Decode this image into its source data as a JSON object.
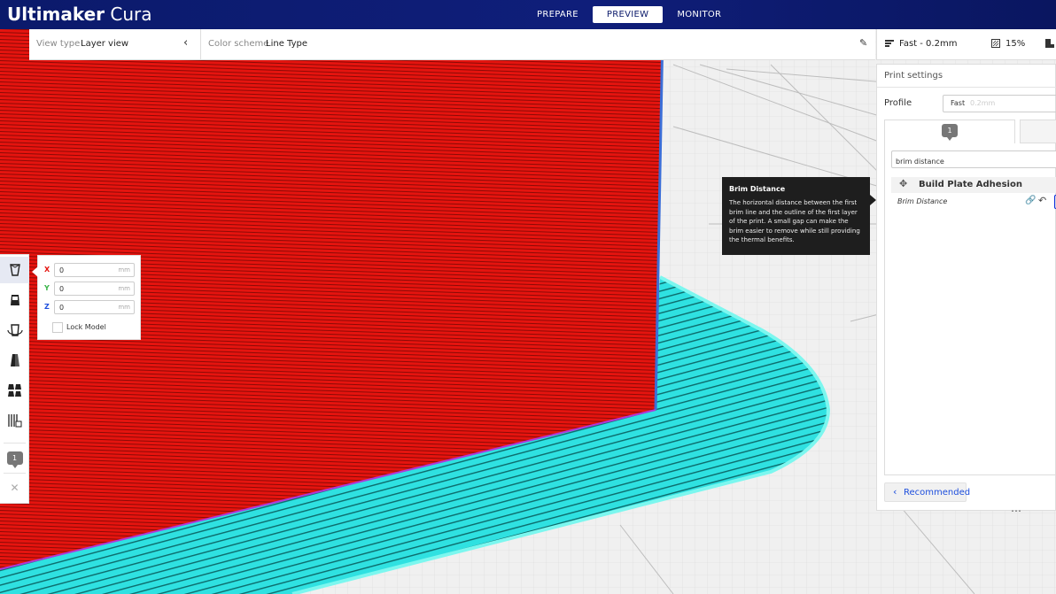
{
  "header": {
    "brand_bold": "Ultimaker",
    "brand_light": "Cura",
    "tabs": [
      {
        "label": "PREPARE",
        "active": false
      },
      {
        "label": "PREVIEW",
        "active": true
      },
      {
        "label": "MONITOR",
        "active": false
      }
    ]
  },
  "view_bar": {
    "view_type_label": "View type",
    "view_type_value": "Layer view",
    "color_scheme_label": "Color scheme",
    "color_scheme_value": "Line Type",
    "collapse_icon": "chevron-left-icon",
    "edit_icon": "pencil-icon"
  },
  "print_summary": {
    "profile": "Fast - 0.2mm",
    "infill": "15%"
  },
  "print_settings": {
    "title": "Print settings",
    "profile_label": "Profile",
    "profile_value": "Fast",
    "profile_subvalue": "0.2mm",
    "search_value": "brim distance",
    "category": "Build Plate Adhesion",
    "setting": "Brim Distance",
    "recommended_label": "Recommended"
  },
  "tooltip": {
    "title": "Brim Distance",
    "body": "The horizontal distance between the first brim line and the outline of the first layer of the print. A small gap can make the brim easier to remove while still providing the thermal benefits."
  },
  "move_panel": {
    "x_label": "X",
    "x_value": "0",
    "x_unit": "mm",
    "y_label": "Y",
    "y_value": "0",
    "y_unit": "mm",
    "z_label": "Z",
    "z_value": "0",
    "z_unit": "mm",
    "lock_label": "Lock Model"
  },
  "toolbar": {
    "tools": [
      "move-tool-icon",
      "scale-tool-icon",
      "rotate-tool-icon",
      "mirror-tool-icon",
      "per-model-settings-icon",
      "support-blocker-icon"
    ],
    "support_badge": "1"
  },
  "colors": {
    "header_bg": "#0f1e7a",
    "accent_blue": "#1d4edd",
    "outer_wall": "#e5140f",
    "skirt_brim": "#2fe1e1",
    "tooltip_bg": "#1e1e1e"
  }
}
